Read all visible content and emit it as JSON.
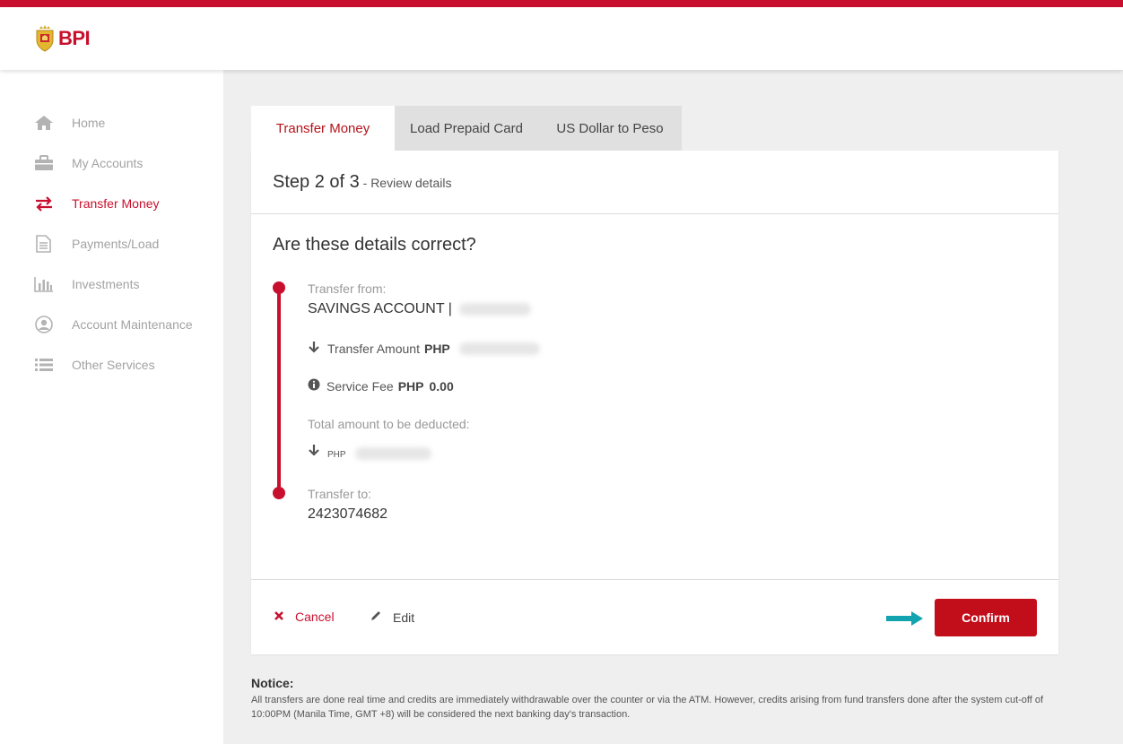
{
  "brand": {
    "name": "BPI",
    "accent_color": "#c8102e"
  },
  "sidebar": {
    "items": [
      {
        "label": "Home",
        "icon": "home-icon",
        "active": false
      },
      {
        "label": "My Accounts",
        "icon": "briefcase-icon",
        "active": false
      },
      {
        "label": "Transfer Money",
        "icon": "transfer-arrows-icon",
        "active": true
      },
      {
        "label": "Payments/Load",
        "icon": "document-icon",
        "active": false
      },
      {
        "label": "Investments",
        "icon": "bar-chart-icon",
        "active": false
      },
      {
        "label": "Account Maintenance",
        "icon": "user-icon",
        "active": false
      },
      {
        "label": "Other Services",
        "icon": "list-icon",
        "active": false
      }
    ]
  },
  "tabs": [
    {
      "label": "Transfer Money",
      "active": true
    },
    {
      "label": "Load Prepaid Card",
      "active": false
    },
    {
      "label": "US Dollar to Peso",
      "active": false
    }
  ],
  "step": {
    "title": "Step 2 of 3",
    "subtitle": " - Review details"
  },
  "review": {
    "question": "Are these details correct?",
    "transfer_from_label": "Transfer from:",
    "transfer_from_value": "SAVINGS ACCOUNT |",
    "transfer_amount_label": "Transfer Amount",
    "transfer_amount_currency": "PHP",
    "service_fee_label": "Service Fee",
    "service_fee_currency": "PHP",
    "service_fee_value": "0.00",
    "total_label": "Total amount to be deducted:",
    "total_currency": "PHP",
    "transfer_to_label": "Transfer to:",
    "transfer_to_value": "2423074682"
  },
  "actions": {
    "cancel": "Cancel",
    "edit": "Edit",
    "confirm": "Confirm"
  },
  "notice": {
    "title": "Notice:",
    "text": "All transfers are done real time and credits are immediately withdrawable over the counter or via the ATM. However, credits arising from fund transfers done after the system cut-off of 10:00PM (Manila Time, GMT +8) will be considered the next banking day's transaction."
  }
}
